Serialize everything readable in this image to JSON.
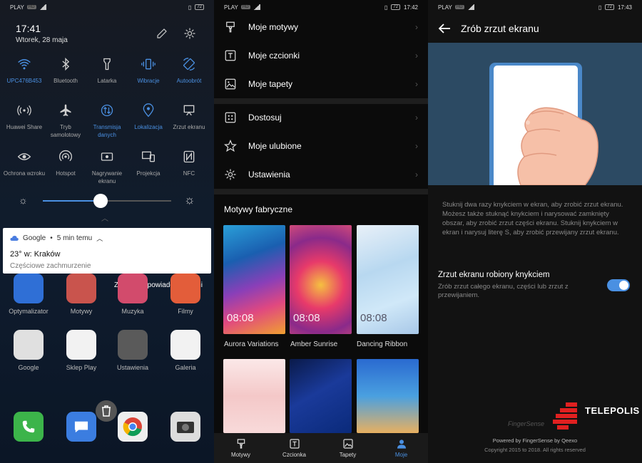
{
  "panel1": {
    "status": {
      "carrier": "PLAY",
      "tag": "HD",
      "battery": "72"
    },
    "time": "17:41",
    "date": "Wtorek, 28 maja",
    "tiles": [
      {
        "label": "UPC476B453",
        "icon": "wifi-icon",
        "on": true
      },
      {
        "label": "Bluetooth",
        "icon": "bluetooth-icon",
        "on": false
      },
      {
        "label": "Latarka",
        "icon": "flashlight-icon",
        "on": false
      },
      {
        "label": "Wibracje",
        "icon": "vibration-icon",
        "on": true
      },
      {
        "label": "Autoobrót",
        "icon": "autorotate-icon",
        "on": true
      },
      {
        "label": "Huawei Share",
        "icon": "share-icon",
        "on": false
      },
      {
        "label": "Tryb samolotowy",
        "icon": "airplane-icon",
        "on": false
      },
      {
        "label": "Transmisja danych",
        "icon": "mobile-data-icon",
        "on": true
      },
      {
        "label": "Lokalizacja",
        "icon": "location-icon",
        "on": true
      },
      {
        "label": "Zrzut ekranu",
        "icon": "screenshot-icon",
        "on": false
      },
      {
        "label": "Ochrona wzroku",
        "icon": "eye-icon",
        "on": false
      },
      {
        "label": "Hotspot",
        "icon": "hotspot-icon",
        "on": false
      },
      {
        "label": "Nagrywanie ekranu",
        "icon": "screen-record-icon",
        "on": false
      },
      {
        "label": "Projekcja",
        "icon": "projection-icon",
        "on": false
      },
      {
        "label": "NFC",
        "icon": "nfc-icon",
        "on": false
      }
    ],
    "brightness": 0.45,
    "notification": {
      "app": "Google",
      "time": "5 min temu",
      "title": "23° w: Kraków",
      "subtitle": "Częściowe zachmurzenie"
    },
    "manage_label": "Zarządzaj powiadomieniami",
    "apps_row1": [
      {
        "label": "Optymalizator",
        "icon": "shield-icon",
        "color": "#2f6fd6"
      },
      {
        "label": "Motywy",
        "icon": "brush-icon",
        "color": "#c9544d"
      },
      {
        "label": "Muzyka",
        "icon": "music-icon",
        "color": "#d24b6c"
      },
      {
        "label": "Filmy",
        "icon": "video-icon",
        "color": "#e35d3a"
      }
    ],
    "apps_row2": [
      {
        "label": "Google",
        "icon": "google-folder-icon",
        "color": "#e0e0e0"
      },
      {
        "label": "Sklep Play",
        "icon": "play-store-icon",
        "color": "#f2f2f2"
      },
      {
        "label": "Ustawienia",
        "icon": "settings-icon",
        "color": "#5a5a5a"
      },
      {
        "label": "Galeria",
        "icon": "gallery-icon",
        "color": "#f2f2f2"
      }
    ]
  },
  "panel2": {
    "status": {
      "carrier": "PLAY",
      "tag": "HD",
      "battery": "72",
      "time": "17:42"
    },
    "menu1": [
      {
        "label": "Moje motywy",
        "icon": "brush-icon"
      },
      {
        "label": "Moje czcionki",
        "icon": "font-icon"
      },
      {
        "label": "Moje tapety",
        "icon": "wallpaper-icon"
      }
    ],
    "menu2": [
      {
        "label": "Dostosuj",
        "icon": "customize-icon"
      },
      {
        "label": "Moje ulubione",
        "icon": "star-icon"
      },
      {
        "label": "Ustawienia",
        "icon": "settings-icon"
      }
    ],
    "section_title": "Motywy fabryczne",
    "themes": [
      {
        "name": "Aurora Variations",
        "clock": "08:08"
      },
      {
        "name": "Amber Sunrise",
        "clock": "08:08"
      },
      {
        "name": "Dancing Ribbon",
        "clock": "08:08"
      }
    ],
    "nav": [
      {
        "label": "Motywy",
        "icon": "brush-icon",
        "active": false
      },
      {
        "label": "Czcionka",
        "icon": "font-icon",
        "active": false
      },
      {
        "label": "Tapety",
        "icon": "wallpaper-icon",
        "active": false
      },
      {
        "label": "Moje",
        "icon": "person-icon",
        "active": true
      }
    ]
  },
  "panel3": {
    "status": {
      "carrier": "PLAY",
      "tag": "HD",
      "battery": "72",
      "time": "17:43"
    },
    "title": "Zrób zrzut ekranu",
    "description": "Stuknij dwa razy knykciem w ekran, aby zrobić zrzut ekranu. Możesz także stuknąć knykciem i narysować zamknięty obszar, aby zrobić zrzut części ekranu. Stuknij knykciem w ekran i narysuj literę S, aby zrobić przewijany zrzut ekranu.",
    "option_title": "Zrzut ekranu robiony knykciem",
    "option_subtitle": "Zrób zrzut całego ekranu, części lub zrzut z przewijaniem.",
    "toggle_on": true,
    "fingersense": "FingerSense",
    "brand": "TELEPOLIS",
    "powered": "Powered by FingerSense by Qeexo",
    "copyright": "Copyright 2015 to 2018. All rights reserved"
  },
  "colors": {
    "accent": "#4a90e2"
  }
}
